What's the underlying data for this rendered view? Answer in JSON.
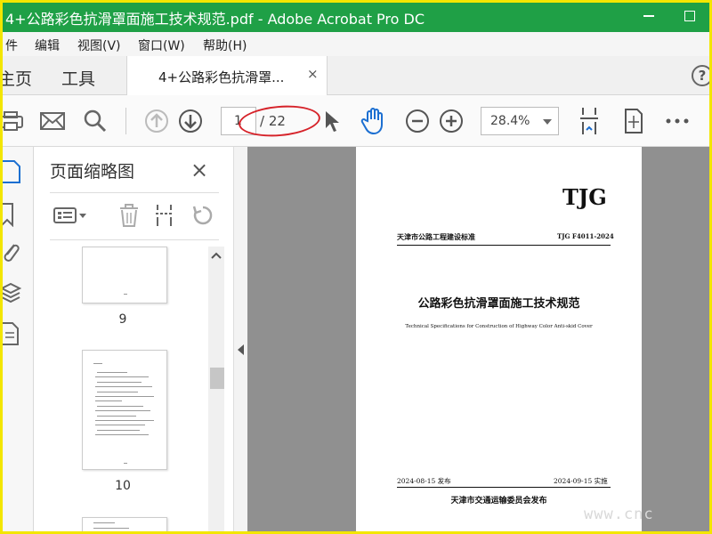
{
  "window": {
    "title": "4+公路彩色抗滑罩面施工技术规范.pdf - Adobe Acrobat Pro DC",
    "title_bar_color": "#1fa046"
  },
  "menu": {
    "file": "件",
    "edit": "编辑",
    "view": "视图(V)",
    "window": "窗口(W)",
    "help": "帮助(H)"
  },
  "tabs": {
    "home": "主页",
    "tools": "工具",
    "document": "4+公路彩色抗滑罩...",
    "close": "×",
    "help": "?"
  },
  "toolbar": {
    "page_current": "1",
    "page_total": "/ 22",
    "zoom": "28.4%",
    "icons": [
      "print-icon",
      "mail-icon",
      "search-icon",
      "prev-page-icon",
      "next-page-icon",
      "select-cursor-icon",
      "hand-tool-icon",
      "zoom-out-icon",
      "zoom-in-icon",
      "scroll-mode-icon",
      "fit-page-icon",
      "more-icon"
    ]
  },
  "panel": {
    "title": "页面缩略图",
    "close": "×",
    "thumbnails": [
      {
        "number": "9"
      },
      {
        "number": "10"
      }
    ]
  },
  "document": {
    "logo": "TJG",
    "standard_series": "天津市公路工程建设标准",
    "standard_code": "TJG F4011-2024",
    "title_cn": "公路彩色抗滑罩面施工技术规范",
    "title_en": "Technical Specifications for Construction of Highway Color Anti-skid Cover",
    "publish_date": "2024-08-15 发布",
    "implement_date": "2024-09-15 实施",
    "issuer": "天津市交通运输委员会发布"
  },
  "watermark": "www.cnc",
  "colors": {
    "accent_blue": "#1c6fd1",
    "annotation_red": "#d6232a",
    "frame_yellow": "#f3e600"
  }
}
